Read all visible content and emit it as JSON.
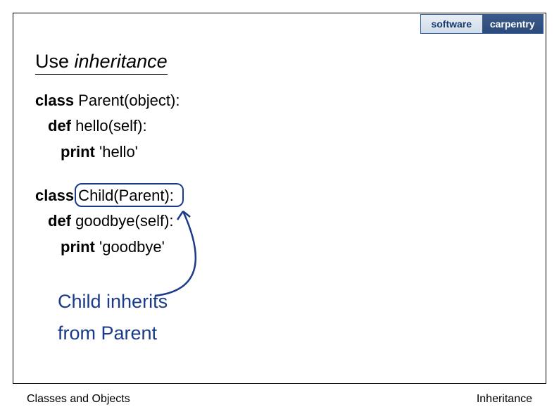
{
  "logo": {
    "left": "software",
    "right": "carpentry"
  },
  "heading": {
    "prefix": "Use ",
    "italic": "inheritance"
  },
  "code1": {
    "line1_kw": "class",
    "line1_rest": " Parent(object):",
    "line2_kw": "def",
    "line2_rest": " hello(self):",
    "line3_kw": "print",
    "line3_rest": " 'hello'"
  },
  "code2": {
    "line1_kw": "class",
    "line1_rest": " Child(Parent):",
    "line2_kw": "def",
    "line2_rest": " goodbye(self):",
    "line3_kw": "print",
    "line3_rest": " 'goodbye'"
  },
  "caption": {
    "line1": "Child inherits",
    "line2": "from Parent"
  },
  "footer": {
    "left": "Classes and Objects",
    "right": "Inheritance"
  }
}
